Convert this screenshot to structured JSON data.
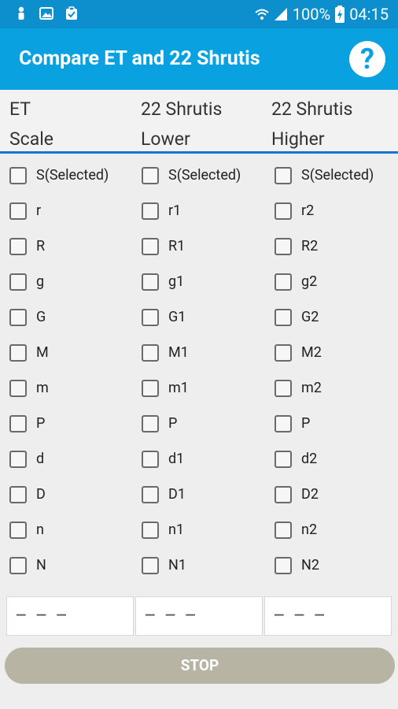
{
  "status_bar": {
    "battery": "100%",
    "time": "04:15"
  },
  "app_bar": {
    "title": "Compare ET and 22 Shrutis",
    "help_label": "?"
  },
  "columns": [
    {
      "header": [
        "ET",
        "Scale"
      ],
      "items": [
        "S(Selected)",
        "r",
        "R",
        "g",
        "G",
        "M",
        "m",
        "P",
        "d",
        "D",
        "n",
        "N"
      ],
      "output": "– – –"
    },
    {
      "header": [
        "22 Shrutis",
        "Lower"
      ],
      "items": [
        "S(Selected)",
        "r1",
        "R1",
        "g1",
        "G1",
        "M1",
        "m1",
        "P",
        "d1",
        "D1",
        "n1",
        "N1"
      ],
      "output": "– – –"
    },
    {
      "header": [
        "22 Shrutis",
        "Higher"
      ],
      "items": [
        "S(Selected)",
        "r2",
        "R2",
        "g2",
        "G2",
        "M2",
        "m2",
        "P",
        "d2",
        "D2",
        "n2",
        "N2"
      ],
      "output": "– – –"
    }
  ],
  "stop_button": "STOP"
}
